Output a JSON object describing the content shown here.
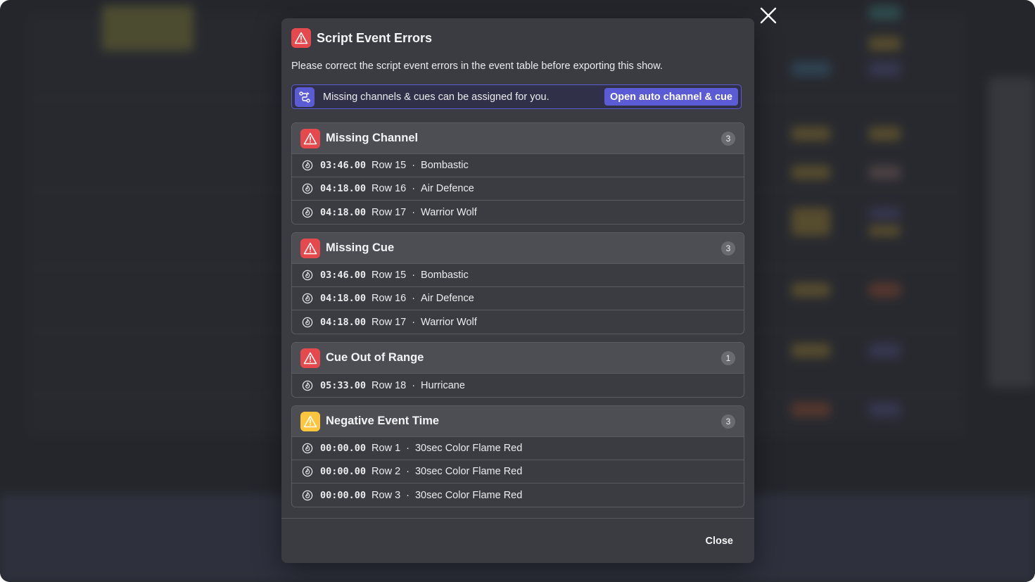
{
  "modal": {
    "title": "Script Event Errors",
    "description": "Please correct the script event errors in the event table before exporting this show.",
    "banner": {
      "text": "Missing channels & cues can be assigned for you.",
      "button_label": "Open auto channel & cue"
    },
    "groups": [
      {
        "title": "Missing Channel",
        "count": "3",
        "severity": "error",
        "rows": [
          {
            "time": "03:46.00",
            "row": "Row 15",
            "name": "Bombastic"
          },
          {
            "time": "04:18.00",
            "row": "Row 16",
            "name": "Air Defence"
          },
          {
            "time": "04:18.00",
            "row": "Row 17",
            "name": "Warrior Wolf"
          }
        ]
      },
      {
        "title": "Missing Cue",
        "count": "3",
        "severity": "error",
        "rows": [
          {
            "time": "03:46.00",
            "row": "Row 15",
            "name": "Bombastic"
          },
          {
            "time": "04:18.00",
            "row": "Row 16",
            "name": "Air Defence"
          },
          {
            "time": "04:18.00",
            "row": "Row 17",
            "name": "Warrior Wolf"
          }
        ]
      },
      {
        "title": "Cue Out of Range",
        "count": "1",
        "severity": "error",
        "rows": [
          {
            "time": "05:33.00",
            "row": "Row 18",
            "name": "Hurricane"
          }
        ]
      },
      {
        "title": "Negative Event Time",
        "count": "3",
        "severity": "warning",
        "rows": [
          {
            "time": "00:00.00",
            "row": "Row 1",
            "name": "30sec Color Flame Red"
          },
          {
            "time": "00:00.00",
            "row": "Row 2",
            "name": "30sec Color Flame Red"
          },
          {
            "time": "00:00.00",
            "row": "Row 3",
            "name": "30sec Color Flame Red"
          }
        ]
      }
    ],
    "close_label": "Close",
    "separator": "·"
  },
  "colors": {
    "error": "#e5484d",
    "warning": "#ffc53d",
    "accent": "#5b5bd6"
  }
}
